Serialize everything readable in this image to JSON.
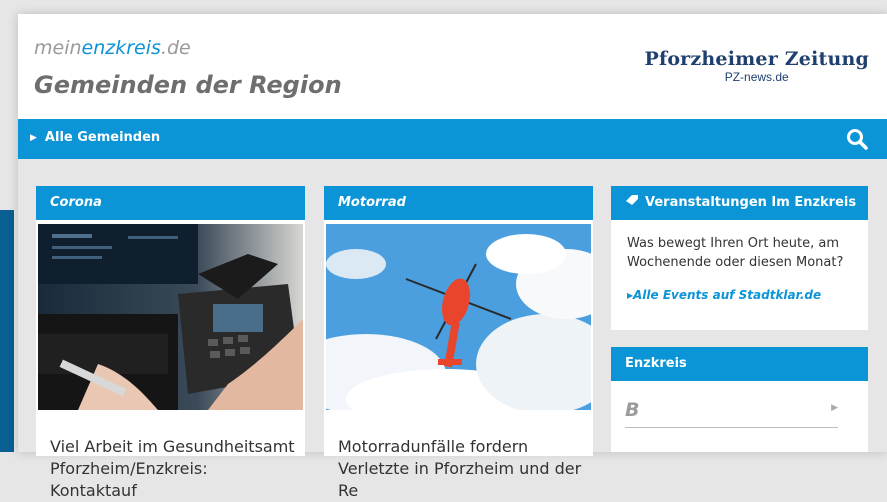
{
  "header": {
    "site_prefix": "mein",
    "site_highlight": "enzkreis",
    "site_suffix": ".de",
    "title": "Gemeinden der Region",
    "logo_name": "Pforzheimer Zeitung",
    "logo_sub": "PZ-news.de"
  },
  "nav": {
    "all_label": "Alle Gemeinden",
    "search_icon": "search-icon"
  },
  "cards": [
    {
      "category": "Corona",
      "headline": "Viel Arbeit im Gesundheitsamt Pforzheim/Enzkreis: Kontaktauf"
    },
    {
      "category": "Motorrad",
      "headline": "Motorradunfälle fordern Verletzte in Pforzheim und der Re"
    }
  ],
  "events": {
    "title": "Veranstaltungen Im Enzkreis",
    "text": "Was bewegt Ihren Ort heute, am Wochenende oder diesen Monat?",
    "link": "▸Alle Events auf Stadtklar.de"
  },
  "enzkreis": {
    "title": "Enzkreis",
    "letter": "B"
  },
  "colors": {
    "accent": "#0c95d6",
    "brand_dark": "#1f3f6e",
    "background": "#e6e6e6"
  }
}
